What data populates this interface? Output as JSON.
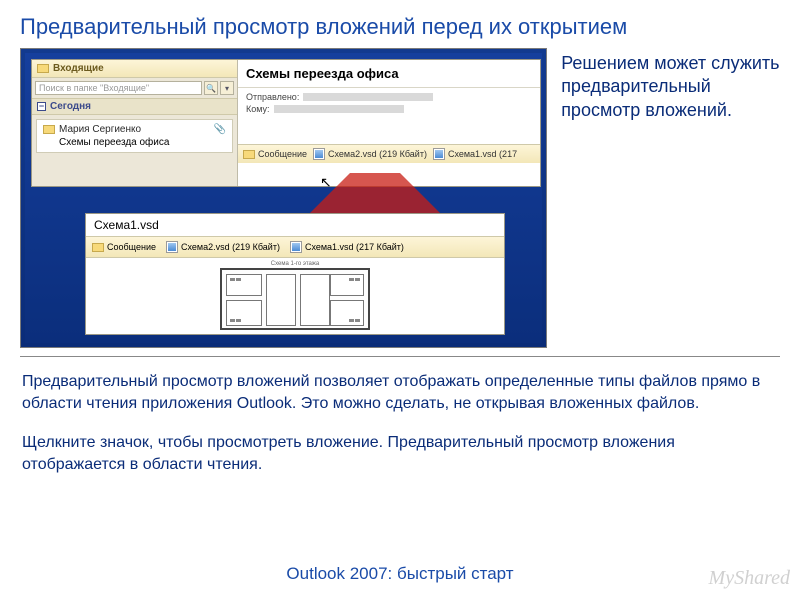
{
  "title": "Предварительный просмотр вложений перед их открытием",
  "right_note": "Решением может служить предварительный просмотр вложений.",
  "folder": {
    "name": "Входящие",
    "search_placeholder": "Поиск в папке \"Входящие\"",
    "today_label": "Сегодня"
  },
  "message": {
    "from": "Мария Сергиенко",
    "subject": "Схемы переезда офиса",
    "reading_title": "Схемы переезда офиса",
    "meta_sent": "Отправлено:",
    "meta_to": "Кому:"
  },
  "attachments": {
    "msg_label": "Сообщение",
    "file1": "Схема2.vsd (219 Кбайт)",
    "file2": "Схема1.vsd (217 Кбайт)",
    "file2_short": "Схема1.vsd (217"
  },
  "lower": {
    "file_title": "Схема1.vsd",
    "plan_caption": "Схема 1-го этажа"
  },
  "paragraphs": {
    "p1": "Предварительный просмотр вложений позволяет отображать определенные типы файлов прямо в области чтения приложения Outlook. Это можно сделать, не открывая вложенных файлов.",
    "p2": "Щелкните значок, чтобы просмотреть вложение. Предварительный просмотр вложения отображается в области чтения."
  },
  "footer": "Outlook 2007: быстрый старт",
  "watermark": "MyShared"
}
